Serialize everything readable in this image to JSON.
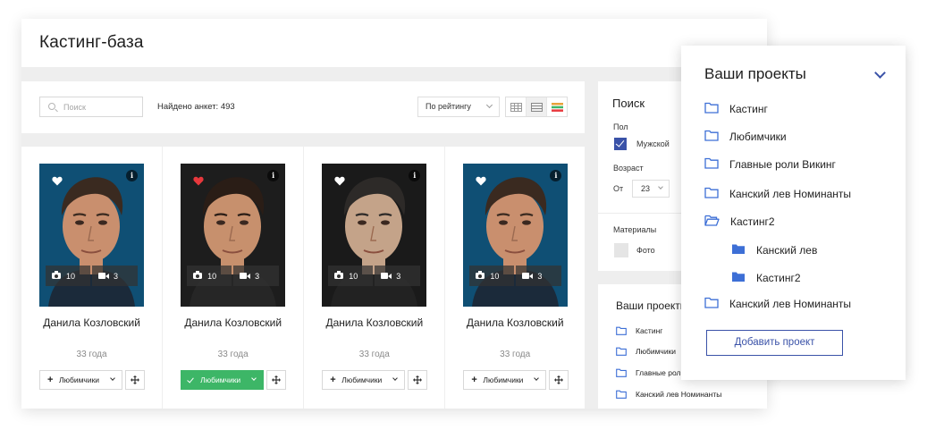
{
  "page": {
    "title": "Кастинг-база"
  },
  "toolbar": {
    "search_placeholder": "Поиск",
    "search_icon": "search-icon",
    "found_text": "Найдено анкет: 493",
    "sort_value": "По рейтингу",
    "view_modes": [
      "grid-view-icon",
      "list-view-icon",
      "colored-list-view-icon"
    ],
    "active_view_index": 1
  },
  "cards": [
    {
      "name": "Данила Козловский",
      "age": "33 года",
      "photos": "10",
      "videos": "3",
      "favorite_label": "Любимчики",
      "in_favorites": false,
      "liked": false
    },
    {
      "name": "Данила Козловский",
      "age": "33 года",
      "photos": "10",
      "videos": "3",
      "favorite_label": "Любимчики",
      "in_favorites": true,
      "liked": true
    },
    {
      "name": "Данила Козловский",
      "age": "33 года",
      "photos": "10",
      "videos": "3",
      "favorite_label": "Любимчики",
      "in_favorites": false,
      "liked": false
    },
    {
      "name": "Данила Козловский",
      "age": "33 года",
      "photos": "10",
      "videos": "3",
      "favorite_label": "Любимчики",
      "in_favorites": false,
      "liked": false
    }
  ],
  "card_info_badge": "i",
  "search_panel": {
    "title": "Поиск",
    "gender_label": "Пол",
    "gender_option": "Мужской",
    "gender_checked": true,
    "age_label": "Возраст",
    "age_from_label": "От",
    "age_from_value": "23",
    "materials_label": "Материалы",
    "materials_option": "Фото",
    "materials_checked": false
  },
  "projects_small": {
    "title": "Ваши проекты",
    "items": [
      "Кастинг",
      "Любимчики",
      "Главные роли Викинг",
      "Канский лев Номинанты"
    ]
  },
  "projects_popup": {
    "title": "Ваши проекты",
    "items": [
      {
        "label": "Кастинг",
        "level": 0,
        "icon": "folder-outline-icon"
      },
      {
        "label": "Любимчики",
        "level": 0,
        "icon": "folder-outline-icon"
      },
      {
        "label": "Главные роли Викинг",
        "level": 0,
        "icon": "folder-outline-icon"
      },
      {
        "label": "Канский лев Номинанты",
        "level": 0,
        "icon": "folder-outline-icon"
      },
      {
        "label": "Кастинг2",
        "level": 0,
        "icon": "folder-open-icon"
      },
      {
        "label": "Канский лев",
        "level": 1,
        "icon": "folder-filled-icon"
      },
      {
        "label": "Кастинг2",
        "level": 1,
        "icon": "folder-filled-icon"
      },
      {
        "label": "Канский лев Номинанты",
        "level": 0,
        "icon": "folder-outline-icon"
      }
    ],
    "add_button": "Добавить проект"
  },
  "colors": {
    "accent_blue": "#3a52a8",
    "favorite_green": "#3db667",
    "folder_blue": "#3d6fd6",
    "heart_red": "#e8383d"
  }
}
